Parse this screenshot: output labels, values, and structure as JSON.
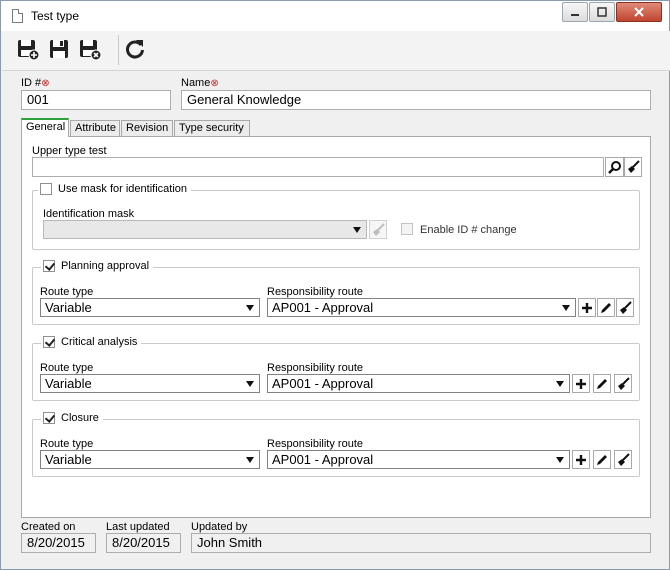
{
  "window": {
    "title": "Test type"
  },
  "toolbar": {
    "save_new_icon": "save-and-new-icon",
    "save_icon": "save-icon",
    "save_close_icon": "save-and-close-icon",
    "refresh_icon": "refresh-icon"
  },
  "header": {
    "id_label": "ID #",
    "id_value": "001",
    "name_label": "Name",
    "name_value": "General Knowledge"
  },
  "tabs": [
    {
      "label": "General"
    },
    {
      "label": "Attribute"
    },
    {
      "label": "Revision"
    },
    {
      "label": "Type security"
    }
  ],
  "general": {
    "upper_type_label": "Upper type test",
    "upper_type_value": "",
    "mask": {
      "checkbox_label": "Use mask for identification",
      "checked": false,
      "mask_label": "Identification mask",
      "mask_value": "",
      "enable_change_label": "Enable ID # change"
    },
    "sections": [
      {
        "title": "Planning approval",
        "checked": true,
        "route_type_label": "Route type",
        "route_type_value": "Variable",
        "resp_route_label": "Responsibility route",
        "resp_route_value": "AP001 - Approval"
      },
      {
        "title": "Critical analysis",
        "checked": true,
        "route_type_label": "Route type",
        "route_type_value": "Variable",
        "resp_route_label": "Responsibility route",
        "resp_route_value": "AP001 - Approval"
      },
      {
        "title": "Closure",
        "checked": true,
        "route_type_label": "Route type",
        "route_type_value": "Variable",
        "resp_route_label": "Responsibility route",
        "resp_route_value": "AP001 - Approval"
      }
    ]
  },
  "footer": {
    "created_label": "Created on",
    "created_value": "8/20/2015",
    "updated_label": "Last updated",
    "updated_value": "8/20/2015",
    "updated_by_label": "Updated by",
    "updated_by_value": "John Smith"
  }
}
